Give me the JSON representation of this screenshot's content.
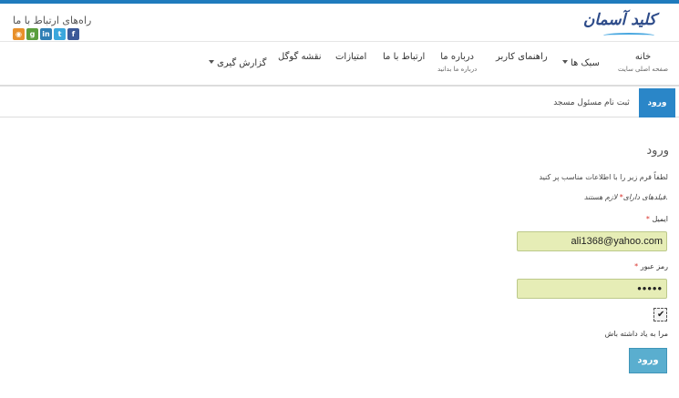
{
  "header": {
    "contact_title": "راه‌های ارتباط با ما",
    "social_icons": [
      "rss-icon",
      "google-plus-icon",
      "linkedin-icon",
      "twitter-icon",
      "facebook-icon"
    ],
    "logo_text": "کلید آسمان"
  },
  "nav": {
    "items": [
      {
        "label": "خانه",
        "sub": "صفحه اصلی سایت"
      },
      {
        "label": "سبک ها",
        "sub": ""
      },
      {
        "label": "راهنمای کاربر",
        "sub": ""
      },
      {
        "label": "درباره ما",
        "sub": "درباره ما بدانید"
      },
      {
        "label": "ارتباط با ما",
        "sub": ""
      },
      {
        "label": "امتیازات",
        "sub": ""
      },
      {
        "label": "نقشه گوگل",
        "sub": ""
      },
      {
        "label": "گزارش گیری",
        "sub": ""
      }
    ]
  },
  "tabs": {
    "active": "ورود",
    "other": "ثبت نام مسئول مسجد"
  },
  "form": {
    "title": "ورود",
    "intro": "لطفاً فرم زیر را با اطلاعات مناسب پر کنید",
    "required_note_prefix": "فیلدهای دارای",
    "required_note_suffix": "لازم هستند.",
    "star": "*",
    "email_label": "ایمیل",
    "email_value": "ali1368@yahoo.com",
    "password_label": "رمز عبور",
    "password_value": "•••••",
    "remember_label": "مرا به یاد داشته باش",
    "remember_checked": true,
    "submit_label": "ورود"
  },
  "colors": {
    "accent": "#2a86c8",
    "input_bg": "#e6edb6",
    "button": "#5aaecf"
  }
}
